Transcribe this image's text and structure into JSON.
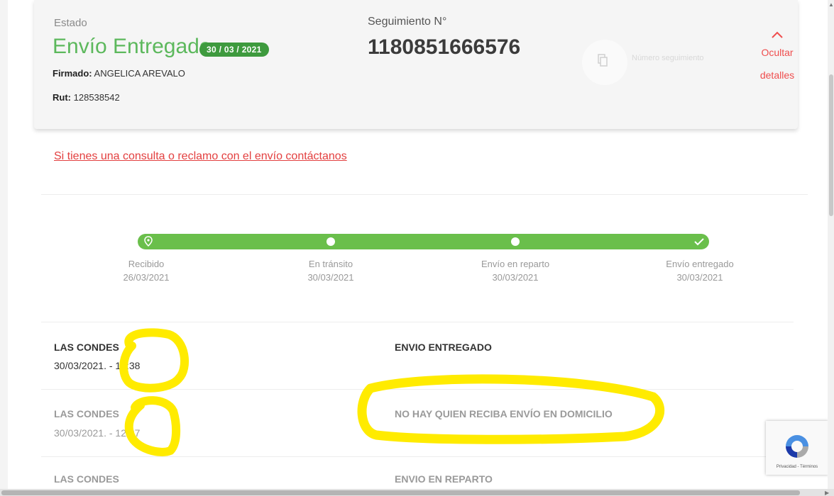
{
  "card": {
    "estado_label": "Estado",
    "status": "Envío Entregado",
    "status_date": "30 / 03 / 2021",
    "firmado_label": "Firmado:",
    "firmado_value": "ANGELICA AREVALO",
    "rut_label": "Rut:",
    "rut_value": "128538542",
    "seguimiento_label": "Seguimiento N°",
    "tracking_number": "1180851666576",
    "copy_text": "Número seguimiento ",
    "hide_details": "Ocultar detalles"
  },
  "contact_link": "Si tienes una consulta o reclamo con el envío contáctanos",
  "progress": {
    "color": "#6abf4b",
    "steps": [
      {
        "label": "Recibido",
        "date": "26/03/2021",
        "icon": "location-pin-icon"
      },
      {
        "label": "En tránsito",
        "date": "30/03/2021",
        "icon": "dot-icon"
      },
      {
        "label": "Envío en reparto",
        "date": "30/03/2021",
        "icon": "dot-icon"
      },
      {
        "label": "Envío entregado",
        "date": "30/03/2021",
        "icon": "check-icon"
      }
    ]
  },
  "events": [
    {
      "place": "LAS CONDES",
      "date": "30/03/2021.",
      "time": "- 12:38",
      "description": "ENVIO ENTREGADO"
    },
    {
      "place": "LAS CONDES",
      "date": "30/03/2021.",
      "time": "- 12:37",
      "description": "NO HAY QUIEN RECIBA ENVÍO EN DOMICILIO"
    },
    {
      "place": "LAS CONDES",
      "date": "",
      "time": "",
      "description": "ENVIO EN REPARTO"
    }
  ],
  "recaptcha": {
    "text": "Privacidad - Términos",
    "icon": "recaptcha-icon"
  },
  "colors": {
    "accent_green": "#5cb85c",
    "accent_red": "#ef4d4d",
    "highlight": "#ffeb00"
  }
}
